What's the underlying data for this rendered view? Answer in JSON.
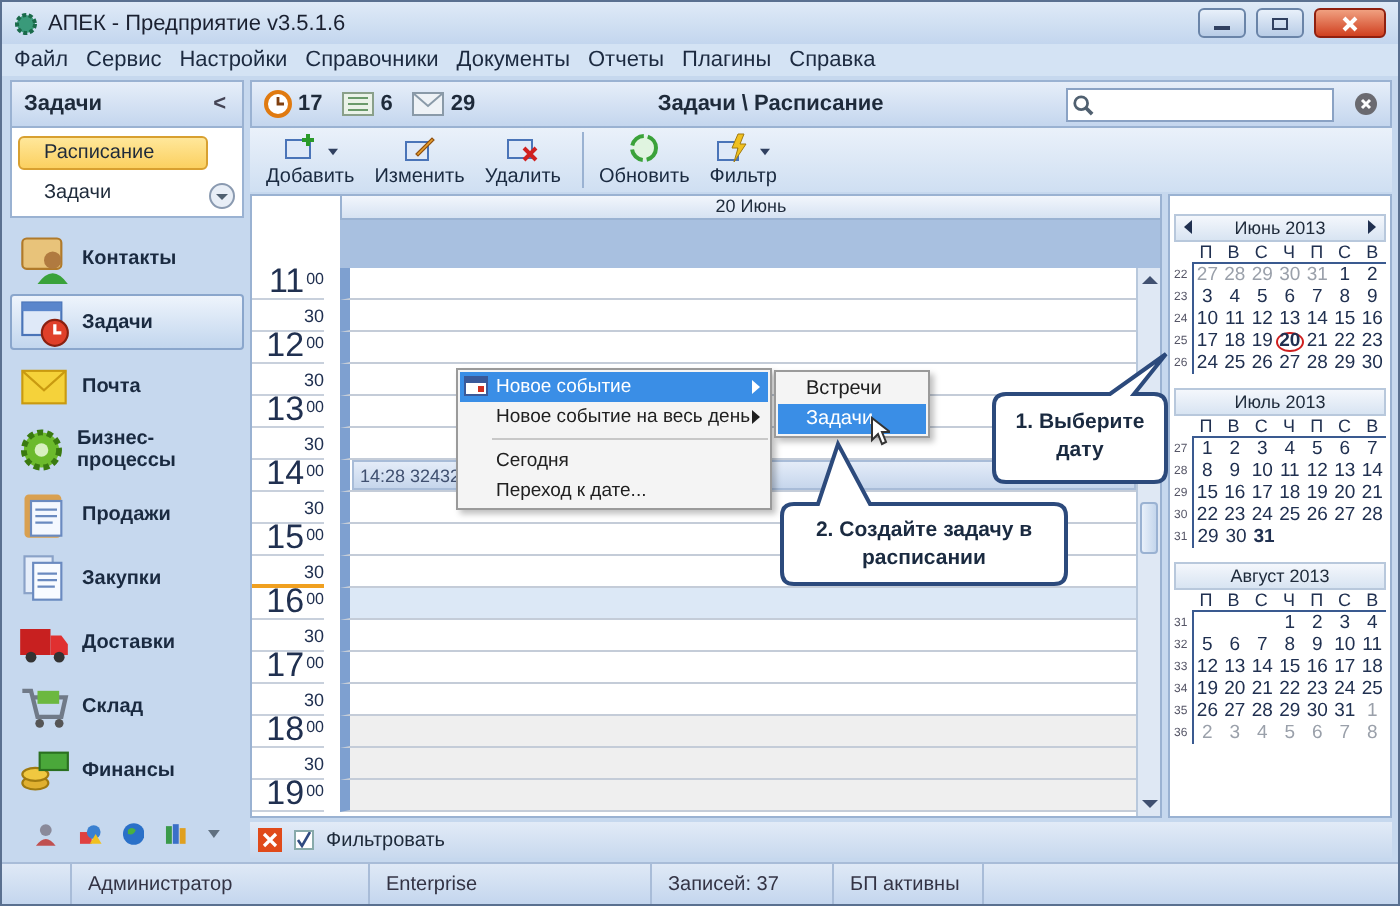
{
  "window": {
    "title": "АПЕК - Предприятие v3.5.1.6"
  },
  "menu": [
    "Файл",
    "Сервис",
    "Настройки",
    "Справочники",
    "Документы",
    "Отчеты",
    "Плагины",
    "Справка"
  ],
  "sidebar": {
    "title": "Задачи",
    "collapse": "<",
    "views": [
      {
        "label": "Расписание",
        "selected": true
      },
      {
        "label": "Задачи",
        "selected": false
      }
    ],
    "modules": [
      {
        "label": "Контакты",
        "kind": "contacts",
        "selected": false
      },
      {
        "label": "Задачи",
        "kind": "tasks",
        "selected": true
      },
      {
        "label": "Почта",
        "kind": "mail",
        "selected": false
      },
      {
        "label": "Бизнес-процессы",
        "kind": "process",
        "selected": false
      },
      {
        "label": "Продажи",
        "kind": "sales",
        "selected": false
      },
      {
        "label": "Закупки",
        "kind": "purchases",
        "selected": false
      },
      {
        "label": "Доставки",
        "kind": "delivery",
        "selected": false
      },
      {
        "label": "Склад",
        "kind": "warehouse",
        "selected": false
      },
      {
        "label": "Финансы",
        "kind": "finance",
        "selected": false
      }
    ]
  },
  "counters": [
    {
      "value": "17",
      "kind": "clock"
    },
    {
      "value": "6",
      "kind": "list"
    },
    {
      "value": "29",
      "kind": "mail"
    }
  ],
  "breadcrumb": "Задачи \\ Расписание",
  "toolbar": [
    {
      "label": "Добавить",
      "kind": "add",
      "dropdown": true,
      "separator_before": false
    },
    {
      "label": "Изменить",
      "kind": "edit",
      "dropdown": false,
      "separator_before": false
    },
    {
      "label": "Удалить",
      "kind": "delete",
      "dropdown": false,
      "separator_before": false
    },
    {
      "label": "Обновить",
      "kind": "refresh",
      "dropdown": false,
      "separator_before": true
    },
    {
      "label": "Фильтр",
      "kind": "filter",
      "dropdown": true,
      "separator_before": false
    }
  ],
  "schedule": {
    "date": "20 Июнь",
    "hours": [
      {
        "hour": "11",
        "rows": [
          {
            "minutes": "00",
            "kind": "work"
          },
          {
            "minutes": "30",
            "kind": "work"
          }
        ]
      },
      {
        "hour": "12",
        "rows": [
          {
            "minutes": "00",
            "kind": "work"
          },
          {
            "minutes": "30",
            "kind": "work"
          }
        ]
      },
      {
        "hour": "13",
        "rows": [
          {
            "minutes": "00",
            "kind": "work"
          },
          {
            "minutes": "30",
            "kind": "work"
          }
        ]
      },
      {
        "hour": "14",
        "rows": [
          {
            "minutes": "00",
            "kind": "work",
            "event": "14:28 32432"
          },
          {
            "minutes": "30",
            "kind": "work"
          }
        ]
      },
      {
        "hour": "15",
        "rows": [
          {
            "minutes": "00",
            "kind": "work"
          },
          {
            "minutes": "30",
            "kind": "work"
          }
        ]
      },
      {
        "hour": "16",
        "rows": [
          {
            "minutes": "00",
            "kind": "current"
          },
          {
            "minutes": "30",
            "kind": "work"
          }
        ]
      },
      {
        "hour": "17",
        "rows": [
          {
            "minutes": "00",
            "kind": "work"
          },
          {
            "minutes": "30",
            "kind": "work"
          }
        ]
      },
      {
        "hour": "18",
        "rows": [
          {
            "minutes": "00",
            "kind": "off"
          },
          {
            "minutes": "30",
            "kind": "off"
          }
        ]
      },
      {
        "hour": "19",
        "rows": [
          {
            "minutes": "00",
            "kind": "off"
          }
        ]
      }
    ]
  },
  "mini_calendars": [
    {
      "title": "Июнь 2013",
      "nav": true,
      "weekdays": [
        "П",
        "В",
        "С",
        "Ч",
        "П",
        "С",
        "В"
      ],
      "weeks": [
        {
          "number": "22",
          "days": [
            {
              "d": "27",
              "kind": "muted"
            },
            {
              "d": "28",
              "kind": "muted"
            },
            {
              "d": "29",
              "kind": "muted"
            },
            {
              "d": "30",
              "kind": "muted"
            },
            {
              "d": "31",
              "kind": "muted"
            },
            {
              "d": "1",
              "kind": "normal"
            },
            {
              "d": "2",
              "kind": "normal"
            }
          ]
        },
        {
          "number": "23",
          "days": [
            {
              "d": "3",
              "kind": "normal"
            },
            {
              "d": "4",
              "kind": "normal"
            },
            {
              "d": "5",
              "kind": "normal"
            },
            {
              "d": "6",
              "kind": "normal"
            },
            {
              "d": "7",
              "kind": "normal"
            },
            {
              "d": "8",
              "kind": "normal"
            },
            {
              "d": "9",
              "kind": "normal"
            }
          ]
        },
        {
          "number": "24",
          "days": [
            {
              "d": "10",
              "kind": "normal"
            },
            {
              "d": "11",
              "kind": "normal"
            },
            {
              "d": "12",
              "kind": "normal"
            },
            {
              "d": "13",
              "kind": "normal"
            },
            {
              "d": "14",
              "kind": "normal"
            },
            {
              "d": "15",
              "kind": "normal"
            },
            {
              "d": "16",
              "kind": "normal"
            }
          ]
        },
        {
          "number": "25",
          "days": [
            {
              "d": "17",
              "kind": "normal"
            },
            {
              "d": "18",
              "kind": "normal"
            },
            {
              "d": "19",
              "kind": "normal"
            },
            {
              "d": "20",
              "kind": "circled"
            },
            {
              "d": "21",
              "kind": "normal"
            },
            {
              "d": "22",
              "kind": "normal"
            },
            {
              "d": "23",
              "kind": "normal"
            }
          ]
        },
        {
          "number": "26",
          "days": [
            {
              "d": "24",
              "kind": "normal"
            },
            {
              "d": "25",
              "kind": "normal"
            },
            {
              "d": "26",
              "kind": "normal"
            },
            {
              "d": "27",
              "kind": "normal"
            },
            {
              "d": "28",
              "kind": "normal"
            },
            {
              "d": "29",
              "kind": "normal"
            },
            {
              "d": "30",
              "kind": "normal"
            }
          ]
        }
      ]
    },
    {
      "title": "Июль 2013",
      "nav": false,
      "weekdays": [
        "П",
        "В",
        "С",
        "Ч",
        "П",
        "С",
        "В"
      ],
      "weeks": [
        {
          "number": "27",
          "days": [
            {
              "d": "1",
              "kind": "normal"
            },
            {
              "d": "2",
              "kind": "normal"
            },
            {
              "d": "3",
              "kind": "normal"
            },
            {
              "d": "4",
              "kind": "normal"
            },
            {
              "d": "5",
              "kind": "normal"
            },
            {
              "d": "6",
              "kind": "normal"
            },
            {
              "d": "7",
              "kind": "normal"
            }
          ]
        },
        {
          "number": "28",
          "days": [
            {
              "d": "8",
              "kind": "normal"
            },
            {
              "d": "9",
              "kind": "normal"
            },
            {
              "d": "10",
              "kind": "normal"
            },
            {
              "d": "11",
              "kind": "normal"
            },
            {
              "d": "12",
              "kind": "normal"
            },
            {
              "d": "13",
              "kind": "normal"
            },
            {
              "d": "14",
              "kind": "normal"
            }
          ]
        },
        {
          "number": "29",
          "days": [
            {
              "d": "15",
              "kind": "normal"
            },
            {
              "d": "16",
              "kind": "normal"
            },
            {
              "d": "17",
              "kind": "normal"
            },
            {
              "d": "18",
              "kind": "normal"
            },
            {
              "d": "19",
              "kind": "normal"
            },
            {
              "d": "20",
              "kind": "normal"
            },
            {
              "d": "21",
              "kind": "normal"
            }
          ]
        },
        {
          "number": "30",
          "days": [
            {
              "d": "22",
              "kind": "normal"
            },
            {
              "d": "23",
              "kind": "normal"
            },
            {
              "d": "24",
              "kind": "normal"
            },
            {
              "d": "25",
              "kind": "normal"
            },
            {
              "d": "26",
              "kind": "normal"
            },
            {
              "d": "27",
              "kind": "normal"
            },
            {
              "d": "28",
              "kind": "normal"
            }
          ]
        },
        {
          "number": "31",
          "days": [
            {
              "d": "29",
              "kind": "normal"
            },
            {
              "d": "30",
              "kind": "normal"
            },
            {
              "d": "31",
              "kind": "bold"
            }
          ]
        }
      ]
    },
    {
      "title": "Август 2013",
      "nav": false,
      "weekdays": [
        "П",
        "В",
        "С",
        "Ч",
        "П",
        "С",
        "В"
      ],
      "weeks": [
        {
          "number": "31",
          "days": [
            {
              "kind": "blank"
            },
            {
              "kind": "blank"
            },
            {
              "kind": "blank"
            },
            {
              "d": "1",
              "kind": "normal"
            },
            {
              "d": "2",
              "kind": "normal"
            },
            {
              "d": "3",
              "kind": "normal"
            },
            {
              "d": "4",
              "kind": "normal"
            }
          ]
        },
        {
          "number": "32",
          "days": [
            {
              "d": "5",
              "kind": "normal"
            },
            {
              "d": "6",
              "kind": "normal"
            },
            {
              "d": "7",
              "kind": "normal"
            },
            {
              "d": "8",
              "kind": "normal"
            },
            {
              "d": "9",
              "kind": "normal"
            },
            {
              "d": "10",
              "kind": "normal"
            },
            {
              "d": "11",
              "kind": "normal"
            }
          ]
        },
        {
          "number": "33",
          "days": [
            {
              "d": "12",
              "kind": "normal"
            },
            {
              "d": "13",
              "kind": "normal"
            },
            {
              "d": "14",
              "kind": "normal"
            },
            {
              "d": "15",
              "kind": "normal"
            },
            {
              "d": "16",
              "kind": "normal"
            },
            {
              "d": "17",
              "kind": "normal"
            },
            {
              "d": "18",
              "kind": "normal"
            }
          ]
        },
        {
          "number": "34",
          "days": [
            {
              "d": "19",
              "kind": "normal"
            },
            {
              "d": "20",
              "kind": "normal"
            },
            {
              "d": "21",
              "kind": "normal"
            },
            {
              "d": "22",
              "kind": "normal"
            },
            {
              "d": "23",
              "kind": "normal"
            },
            {
              "d": "24",
              "kind": "normal"
            },
            {
              "d": "25",
              "kind": "normal"
            }
          ]
        },
        {
          "number": "35",
          "days": [
            {
              "d": "26",
              "kind": "normal"
            },
            {
              "d": "27",
              "kind": "normal"
            },
            {
              "d": "28",
              "kind": "normal"
            },
            {
              "d": "29",
              "kind": "normal"
            },
            {
              "d": "30",
              "kind": "normal"
            },
            {
              "d": "31",
              "kind": "normal"
            },
            {
              "d": "1",
              "kind": "muted"
            }
          ]
        },
        {
          "number": "36",
          "days": [
            {
              "d": "2",
              "kind": "muted"
            },
            {
              "d": "3",
              "kind": "muted"
            },
            {
              "d": "4",
              "kind": "muted"
            },
            {
              "d": "5",
              "kind": "muted"
            },
            {
              "d": "6",
              "kind": "muted"
            },
            {
              "d": "7",
              "kind": "muted"
            },
            {
              "d": "8",
              "kind": "muted"
            }
          ]
        }
      ]
    }
  ],
  "context_menu": {
    "items": [
      {
        "label": "Новое событие",
        "kind": "calendar",
        "submenu": true,
        "selected": true
      },
      {
        "label": "Новое событие на весь день",
        "kind": "plain",
        "submenu": true,
        "selected": false
      },
      {
        "kind": "separator"
      },
      {
        "label": "Сегодня",
        "kind": "plain",
        "submenu": false,
        "selected": false
      },
      {
        "label": "Переход к дате...",
        "kind": "plain",
        "submenu": false,
        "selected": false
      }
    ]
  },
  "submenu": [
    {
      "label": "Встречи",
      "selected": false
    },
    {
      "label": "Задачи",
      "selected": true
    }
  ],
  "callouts": [
    {
      "text": "1. Выберите дату"
    },
    {
      "text": "2. Создайте задачу в расписании"
    }
  ],
  "filter_bar": {
    "checked": true,
    "label": "Фильтровать"
  },
  "status_bar": [
    "Администратор",
    "Enterprise",
    "Записей: 37",
    "БП активны"
  ]
}
